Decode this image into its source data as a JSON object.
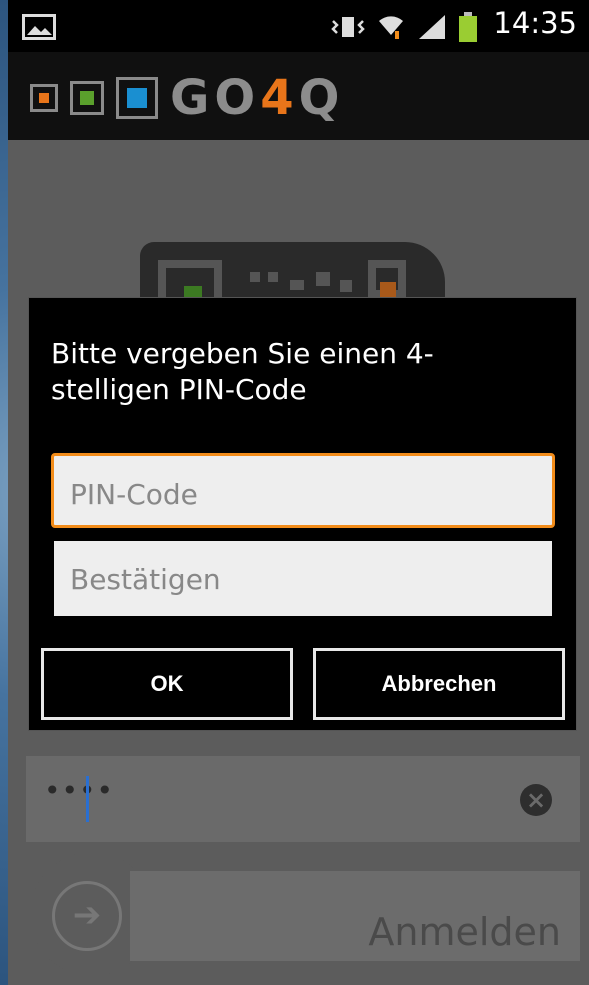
{
  "status": {
    "time": "14:35",
    "icons": [
      "image-icon",
      "vibrate-icon",
      "wifi-icon",
      "signal-icon",
      "battery-icon"
    ]
  },
  "app": {
    "logo_prefix": "GO",
    "logo_four": "4",
    "logo_suffix": "Q",
    "squares": [
      "#e8751a",
      "#5aa02c",
      "#1a8fd1"
    ]
  },
  "dialog": {
    "title": "Bitte vergeben Sie einen 4-stelligen PIN-Code",
    "pin_placeholder": "PIN-Code",
    "confirm_placeholder": "Bestätigen",
    "ok_label": "OK",
    "cancel_label": "Abbrechen"
  },
  "background": {
    "pin_masked": "••••",
    "login_label": "Anmelden"
  },
  "colors": {
    "accent": "#f28c1a"
  }
}
